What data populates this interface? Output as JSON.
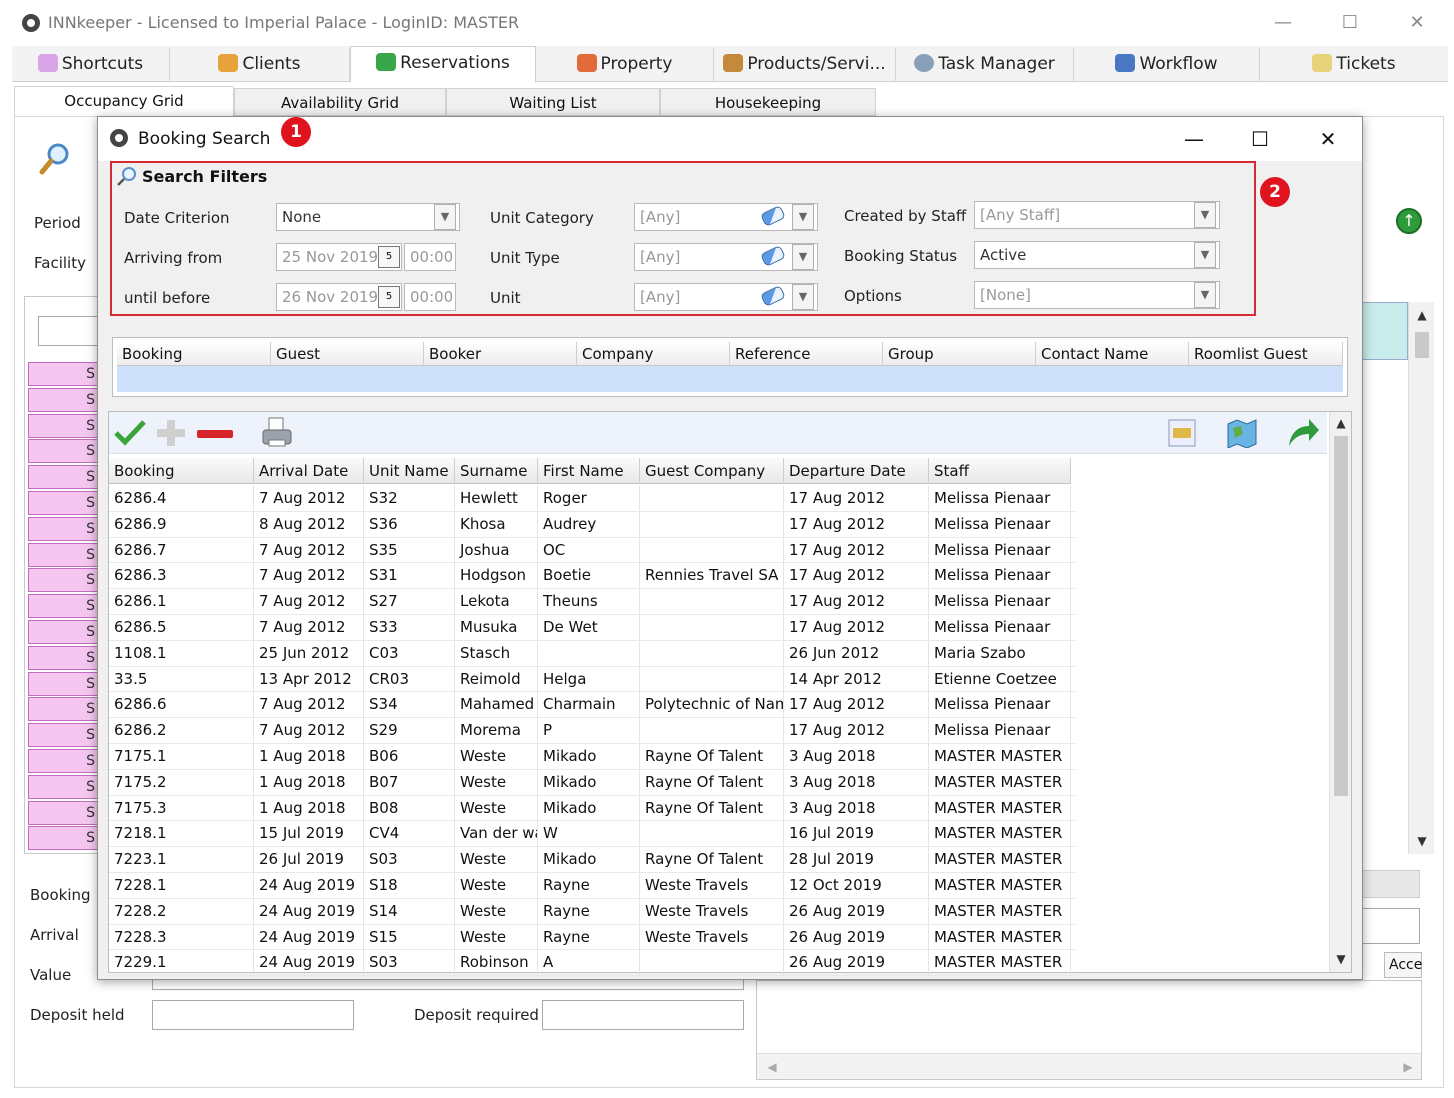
{
  "window": {
    "title": "INNkeeper - Licensed to Imperial Palace - LoginID: MASTER",
    "minimize": "—",
    "maximize": "☐",
    "close": "✕"
  },
  "tabs": [
    "Shortcuts",
    "Clients",
    "Reservations",
    "Property",
    "Products/Servi...",
    "Task Manager",
    "Workflow",
    "Tickets"
  ],
  "subtabs": [
    "Occupancy Grid",
    "Availability Grid",
    "Waiting List",
    "Housekeeping"
  ],
  "background": {
    "period_label": "Period",
    "facility_label": "Facility",
    "booking_label": "Booking",
    "arrival_label": "Arrival",
    "value_label": "Value",
    "deposit_held_label": "Deposit held",
    "deposit_required_label": "Deposit required",
    "acce_label": "Acce",
    "pink_rows": [
      "S",
      "S",
      "S",
      "S",
      "S",
      "S",
      "S",
      "S",
      "S",
      "S",
      "S",
      "S",
      "S",
      "S",
      "S",
      "S",
      "S",
      "S",
      "S",
      "S"
    ]
  },
  "dialog": {
    "title": "Booking Search",
    "badge1": "1",
    "badge2": "2",
    "filters": {
      "title": "Search Filters",
      "date_criterion_label": "Date Criterion",
      "date_criterion_value": "None",
      "arriving_from_label": "Arriving from",
      "arriving_from_date": "25 Nov 2019",
      "arriving_from_time": "00:00",
      "until_before_label": "until before",
      "until_before_date": "26 Nov 2019",
      "until_before_time": "00:00",
      "cal_glyph": "5",
      "unit_category_label": "Unit Category",
      "unit_category_value": "[Any]",
      "unit_type_label": "Unit Type",
      "unit_type_value": "[Any]",
      "unit_label": "Unit",
      "unit_value": "[Any]",
      "created_by_label": "Created by Staff",
      "created_by_value": "[Any Staff]",
      "booking_status_label": "Booking Status",
      "booking_status_value": "Active",
      "options_label": "Options",
      "options_value": "[None]"
    },
    "criteria_columns": [
      "Booking",
      "Guest",
      "Booker",
      "Company",
      "Reference",
      "Group",
      "Contact Name",
      "Roomlist Guest"
    ],
    "results": {
      "columns": [
        "Booking",
        "Arrival Date",
        "Unit Name",
        "Surname",
        "First Name",
        "Guest Company",
        "Departure Date",
        "Staff"
      ],
      "rows": [
        [
          "6286.4",
          "7 Aug 2012",
          "S32",
          "Hewlett",
          "Roger",
          "",
          "17 Aug 2012",
          "Melissa Pienaar"
        ],
        [
          "6286.9",
          "8 Aug 2012",
          "S36",
          "Khosa",
          "Audrey",
          "",
          "17 Aug 2012",
          "Melissa Pienaar"
        ],
        [
          "6286.7",
          "7 Aug 2012",
          "S35",
          "Joshua",
          "OC",
          "",
          "17 Aug 2012",
          "Melissa Pienaar"
        ],
        [
          "6286.3",
          "7 Aug 2012",
          "S31",
          "Hodgson",
          "Boetie",
          "Rennies Travel SA",
          "17 Aug 2012",
          "Melissa Pienaar"
        ],
        [
          "6286.1",
          "7 Aug 2012",
          "S27",
          "Lekota",
          "Theuns",
          "",
          "17 Aug 2012",
          "Melissa Pienaar"
        ],
        [
          "6286.5",
          "7 Aug 2012",
          "S33",
          "Musuka",
          "De Wet",
          "",
          "17 Aug 2012",
          "Melissa Pienaar"
        ],
        [
          "1108.1",
          "25 Jun 2012",
          "C03",
          "Stasch",
          "",
          "",
          "26 Jun 2012",
          "Maria Szabo"
        ],
        [
          "33.5",
          "13 Apr 2012",
          "CR03",
          "Reimold",
          "Helga",
          "",
          "14 Apr 2012",
          "Etienne Coetzee"
        ],
        [
          "6286.6",
          "7 Aug 2012",
          "S34",
          "Mahamed",
          "Charmain",
          "Polytechnic of Nami",
          "17 Aug 2012",
          "Melissa Pienaar"
        ],
        [
          "6286.2",
          "7 Aug 2012",
          "S29",
          "Morema",
          "P",
          "",
          "17 Aug 2012",
          "Melissa Pienaar"
        ],
        [
          "7175.1",
          "1 Aug 2018",
          "B06",
          "Weste",
          "Mikado",
          "Rayne Of Talent",
          "3 Aug 2018",
          "MASTER MASTER"
        ],
        [
          "7175.2",
          "1 Aug 2018",
          "B07",
          "Weste",
          "Mikado",
          "Rayne Of Talent",
          "3 Aug 2018",
          "MASTER MASTER"
        ],
        [
          "7175.3",
          "1 Aug 2018",
          "B08",
          "Weste",
          "Mikado",
          "Rayne Of Talent",
          "3 Aug 2018",
          "MASTER MASTER"
        ],
        [
          "7218.1",
          "15 Jul 2019",
          "CV4",
          "Van der wa",
          "W",
          "",
          "16 Jul 2019",
          "MASTER MASTER"
        ],
        [
          "7223.1",
          "26 Jul 2019",
          "S03",
          "Weste",
          "Mikado",
          "Rayne Of Talent",
          "28 Jul 2019",
          "MASTER MASTER"
        ],
        [
          "7228.1",
          "24 Aug 2019",
          "S18",
          "Weste",
          "Rayne",
          "Weste Travels",
          "12 Oct 2019",
          "MASTER MASTER"
        ],
        [
          "7228.2",
          "24 Aug 2019",
          "S14",
          "Weste",
          "Rayne",
          "Weste Travels",
          "26 Aug 2019",
          "MASTER MASTER"
        ],
        [
          "7228.3",
          "24 Aug 2019",
          "S15",
          "Weste",
          "Rayne",
          "Weste Travels",
          "26 Aug 2019",
          "MASTER MASTER"
        ],
        [
          "7229.1",
          "24 Aug 2019",
          "S03",
          "Robinson",
          "A",
          "",
          "26 Aug 2019",
          "MASTER MASTER"
        ]
      ]
    }
  }
}
